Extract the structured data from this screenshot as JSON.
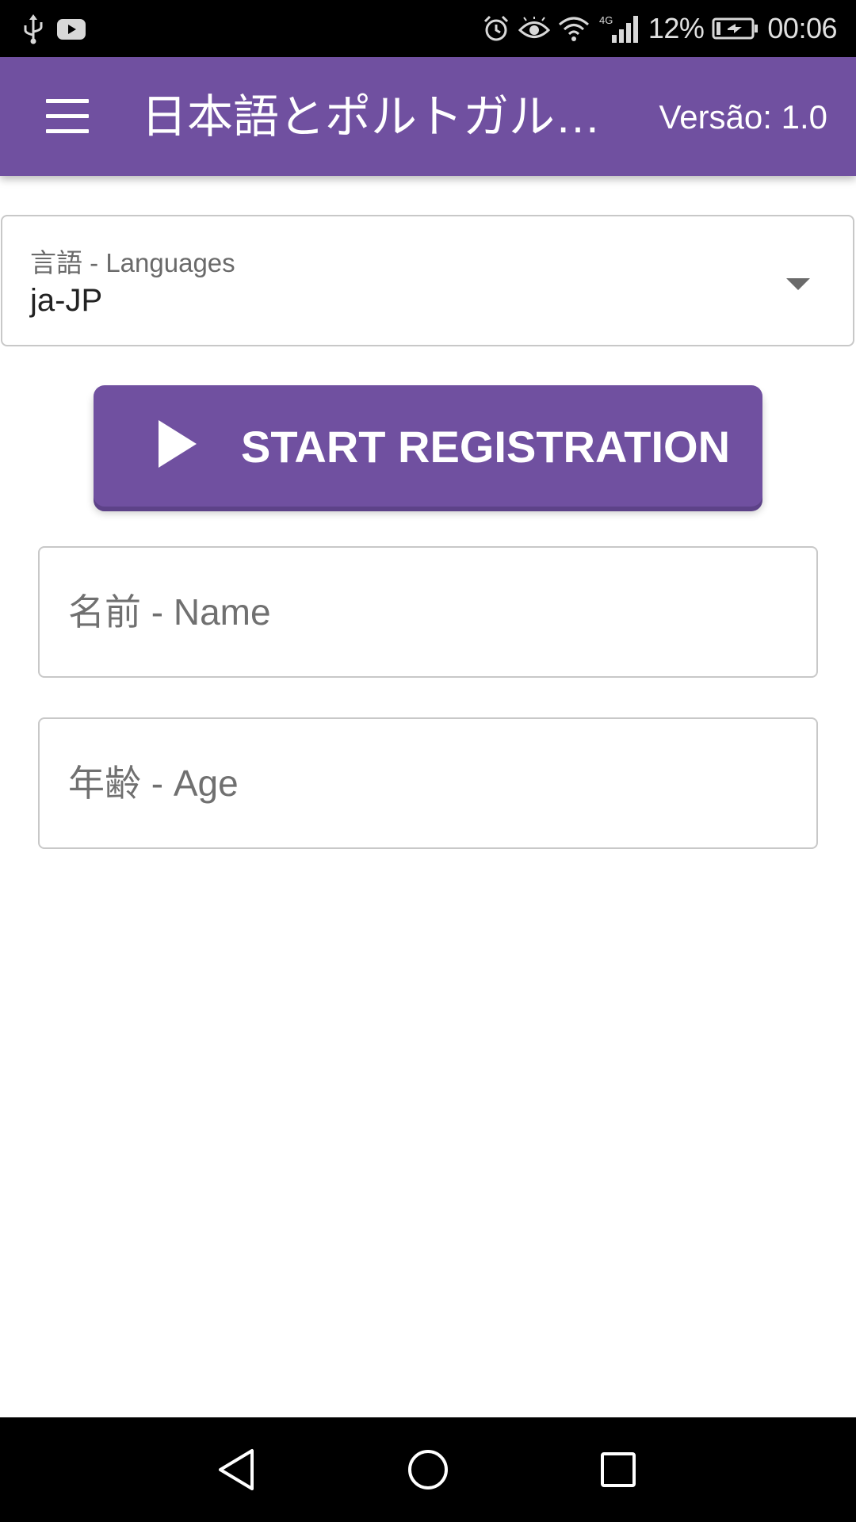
{
  "status_bar": {
    "battery": "12%",
    "time": "00:06",
    "network": "4G",
    "icons": [
      "usb-icon",
      "youtube-icon",
      "alarm-icon",
      "eye-icon",
      "wifi-icon",
      "signal-icon",
      "battery-icon"
    ]
  },
  "app_bar": {
    "title": "日本語とポルトガル語…",
    "version": "Versão: 1.0"
  },
  "language": {
    "label": "言語 - Languages",
    "value": "ja-JP"
  },
  "start_button": {
    "label": "START REGISTRATION"
  },
  "fields": {
    "name_placeholder": "名前 - Name",
    "age_placeholder": "年齢 - Age"
  },
  "colors": {
    "primary": "#7050a0",
    "background": "#ffffff",
    "border": "#c8c8c8"
  }
}
